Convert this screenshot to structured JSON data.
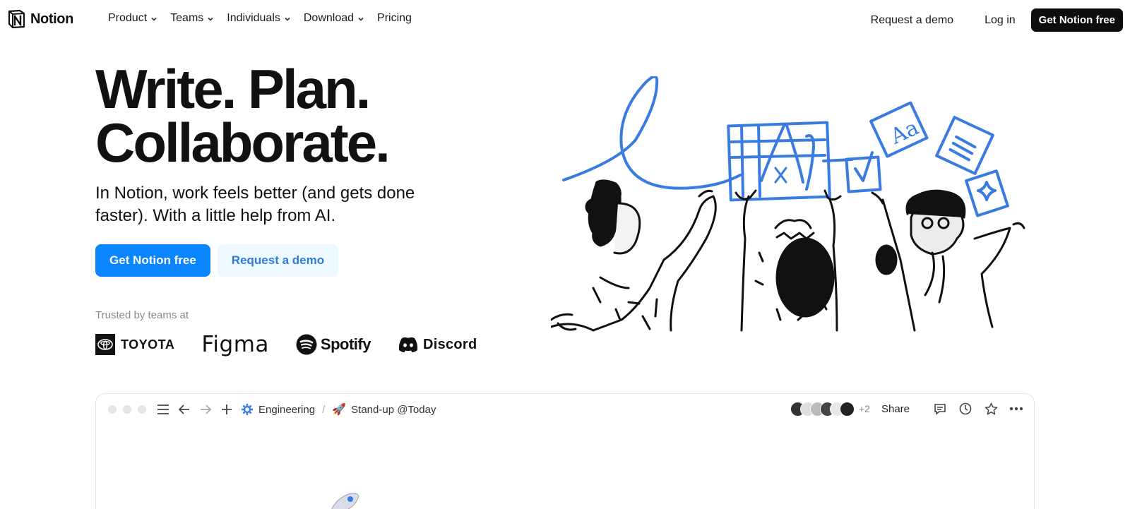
{
  "nav": {
    "logo_text": "Notion",
    "menu": [
      {
        "label": "Product",
        "has_dropdown": true
      },
      {
        "label": "Teams",
        "has_dropdown": true
      },
      {
        "label": "Individuals",
        "has_dropdown": true
      },
      {
        "label": "Download",
        "has_dropdown": true
      },
      {
        "label": "Pricing",
        "has_dropdown": false
      }
    ],
    "request_demo": "Request a demo",
    "login": "Log in",
    "cta": "Get Notion free"
  },
  "hero": {
    "title_line1": "Write. Plan.",
    "title_line2": "Collaborate.",
    "subtitle": "In Notion, work feels better (and gets done faster). With a little help from AI.",
    "primary_button": "Get Notion free",
    "secondary_button": "Request a demo",
    "trusted_label": "Trusted by teams at",
    "brands": [
      "TOYOTA",
      "Figma",
      "Spotify",
      "Discord"
    ]
  },
  "preview": {
    "breadcrumb_workspace": "Engineering",
    "breadcrumb_separator": "/",
    "breadcrumb_page": "Stand-up @Today",
    "extra_members": "+2",
    "share": "Share"
  },
  "colors": {
    "primary_blue": "#0a85ff",
    "light_button_bg": "#eef8ff",
    "light_button_text": "#2f7bd6",
    "illustration_blue": "#3a7be0",
    "text_dark": "#111111"
  },
  "icons": {
    "nav_chevron": "chevron-down-icon",
    "toolbar": [
      "menu-icon",
      "back-arrow-icon",
      "forward-arrow-icon",
      "plus-icon",
      "gear-icon",
      "rocket-icon"
    ],
    "right": [
      "comment-icon",
      "clock-icon",
      "star-icon",
      "more-icon"
    ]
  }
}
